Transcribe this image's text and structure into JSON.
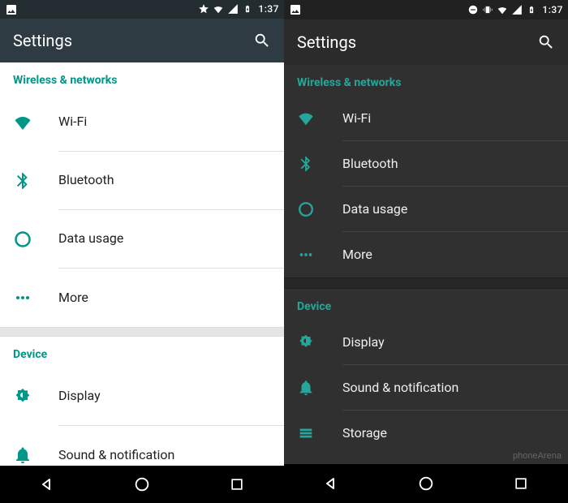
{
  "colors": {
    "accent": "#009688",
    "accent_dark_theme": "#26a69a"
  },
  "left": {
    "status": {
      "time": "1:37",
      "icons": [
        "picture-icon",
        "star-icon",
        "wifi-icon",
        "signal-icon",
        "battery-charging-icon"
      ]
    },
    "title": "Settings",
    "sections": [
      {
        "header": "Wireless & networks",
        "items": [
          {
            "icon": "wifi-icon",
            "label": "Wi-Fi"
          },
          {
            "icon": "bluetooth-icon",
            "label": "Bluetooth"
          },
          {
            "icon": "data-usage-icon",
            "label": "Data usage"
          },
          {
            "icon": "more-horiz-icon",
            "label": "More"
          }
        ]
      },
      {
        "header": "Device",
        "items": [
          {
            "icon": "brightness-icon",
            "label": "Display"
          },
          {
            "icon": "bell-icon",
            "label": "Sound & notification"
          }
        ]
      }
    ]
  },
  "right": {
    "status": {
      "time": "1:37",
      "icons": [
        "picture-icon",
        "dnd-icon",
        "vibrate-icon",
        "wifi-icon",
        "signal-icon",
        "battery-charging-icon"
      ]
    },
    "title": "Settings",
    "sections": [
      {
        "header": "Wireless & networks",
        "items": [
          {
            "icon": "wifi-icon",
            "label": "Wi-Fi"
          },
          {
            "icon": "bluetooth-icon",
            "label": "Bluetooth"
          },
          {
            "icon": "data-usage-icon",
            "label": "Data usage"
          },
          {
            "icon": "more-horiz-icon",
            "label": "More"
          }
        ]
      },
      {
        "header": "Device",
        "items": [
          {
            "icon": "brightness-icon",
            "label": "Display"
          },
          {
            "icon": "bell-icon",
            "label": "Sound & notification"
          },
          {
            "icon": "storage-icon",
            "label": "Storage"
          }
        ]
      }
    ]
  },
  "watermark": "phoneArena"
}
